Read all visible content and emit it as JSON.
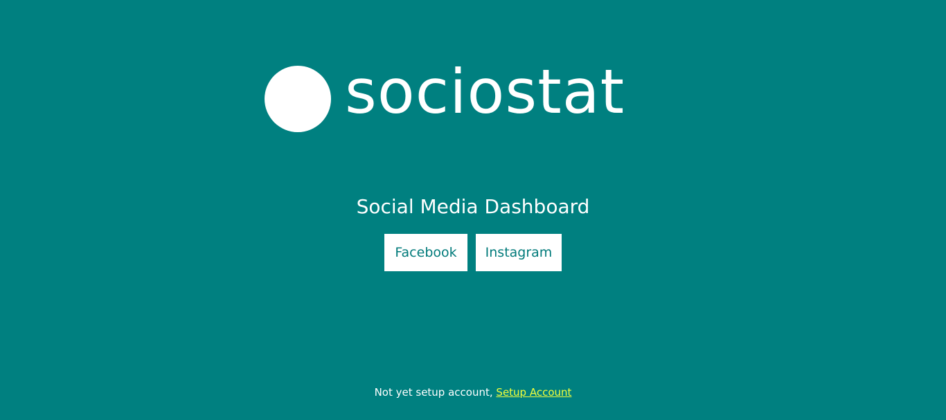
{
  "brand": {
    "name": "sociostat",
    "logo_icon": "circle-logo-icon"
  },
  "main": {
    "title": "Social Media Dashboard",
    "buttons": [
      {
        "label": "Facebook"
      },
      {
        "label": "Instagram"
      }
    ]
  },
  "footer": {
    "prefix": "Not yet setup account,",
    "link_label": "Setup Account"
  },
  "colors": {
    "background": "#008080",
    "button_bg": "#ffffff",
    "button_text": "#007a7a",
    "link": "#f2ff3a"
  }
}
